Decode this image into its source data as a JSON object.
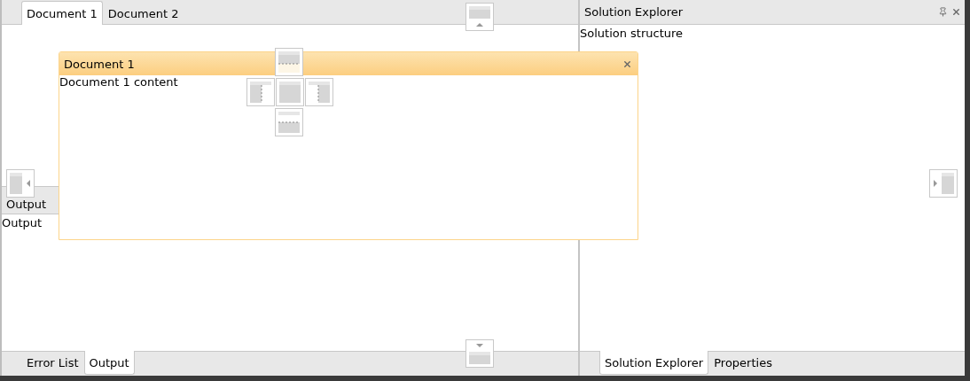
{
  "document_tabs": [
    {
      "label": "Document 1",
      "selected": true
    },
    {
      "label": "Document 2",
      "selected": false
    }
  ],
  "output_panel": {
    "title": "Output",
    "content": "Output"
  },
  "bottom_left_tabs": [
    {
      "label": "Error List",
      "selected": false
    },
    {
      "label": "Output",
      "selected": true
    }
  ],
  "solution_explorer": {
    "title": "Solution Explorer",
    "content": "Solution structure"
  },
  "bottom_right_tabs": [
    {
      "label": "Solution Explorer",
      "selected": true
    },
    {
      "label": "Properties",
      "selected": false
    }
  ],
  "floating_window": {
    "title": "Document 1",
    "content": "Document 1 content"
  }
}
